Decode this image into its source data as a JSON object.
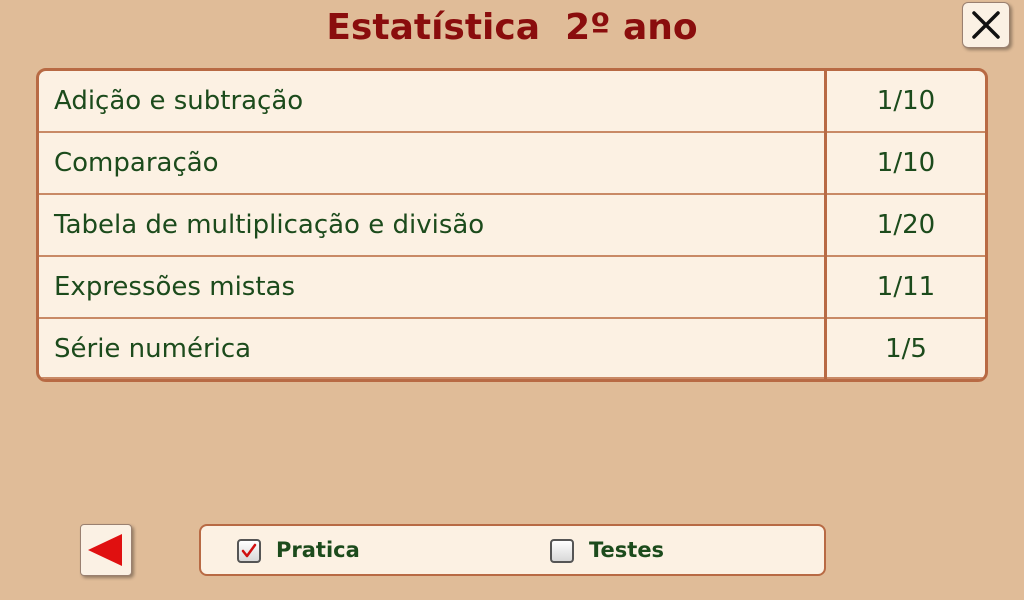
{
  "header": {
    "title": "Estatística  2º ano",
    "close_icon": "close-icon"
  },
  "stats": {
    "rows": [
      {
        "label": "Adição e subtração",
        "value": "1/10"
      },
      {
        "label": "Comparação",
        "value": "1/10"
      },
      {
        "label": "Tabela de multiplicação e divisão",
        "value": "1/20"
      },
      {
        "label": "Expressões mistas",
        "value": "1/11"
      },
      {
        "label": "Série numérica",
        "value": "1/5"
      }
    ]
  },
  "footer": {
    "back_icon": "back-arrow-icon",
    "modes": [
      {
        "label": "Pratica",
        "checked": true
      },
      {
        "label": "Testes",
        "checked": false
      }
    ]
  },
  "colors": {
    "background": "#e0bc98",
    "title": "#8a0d0d",
    "text": "#1c4b1c",
    "border": "#b86a44",
    "panel": "#fcf1e3",
    "back_arrow": "#e01010"
  }
}
